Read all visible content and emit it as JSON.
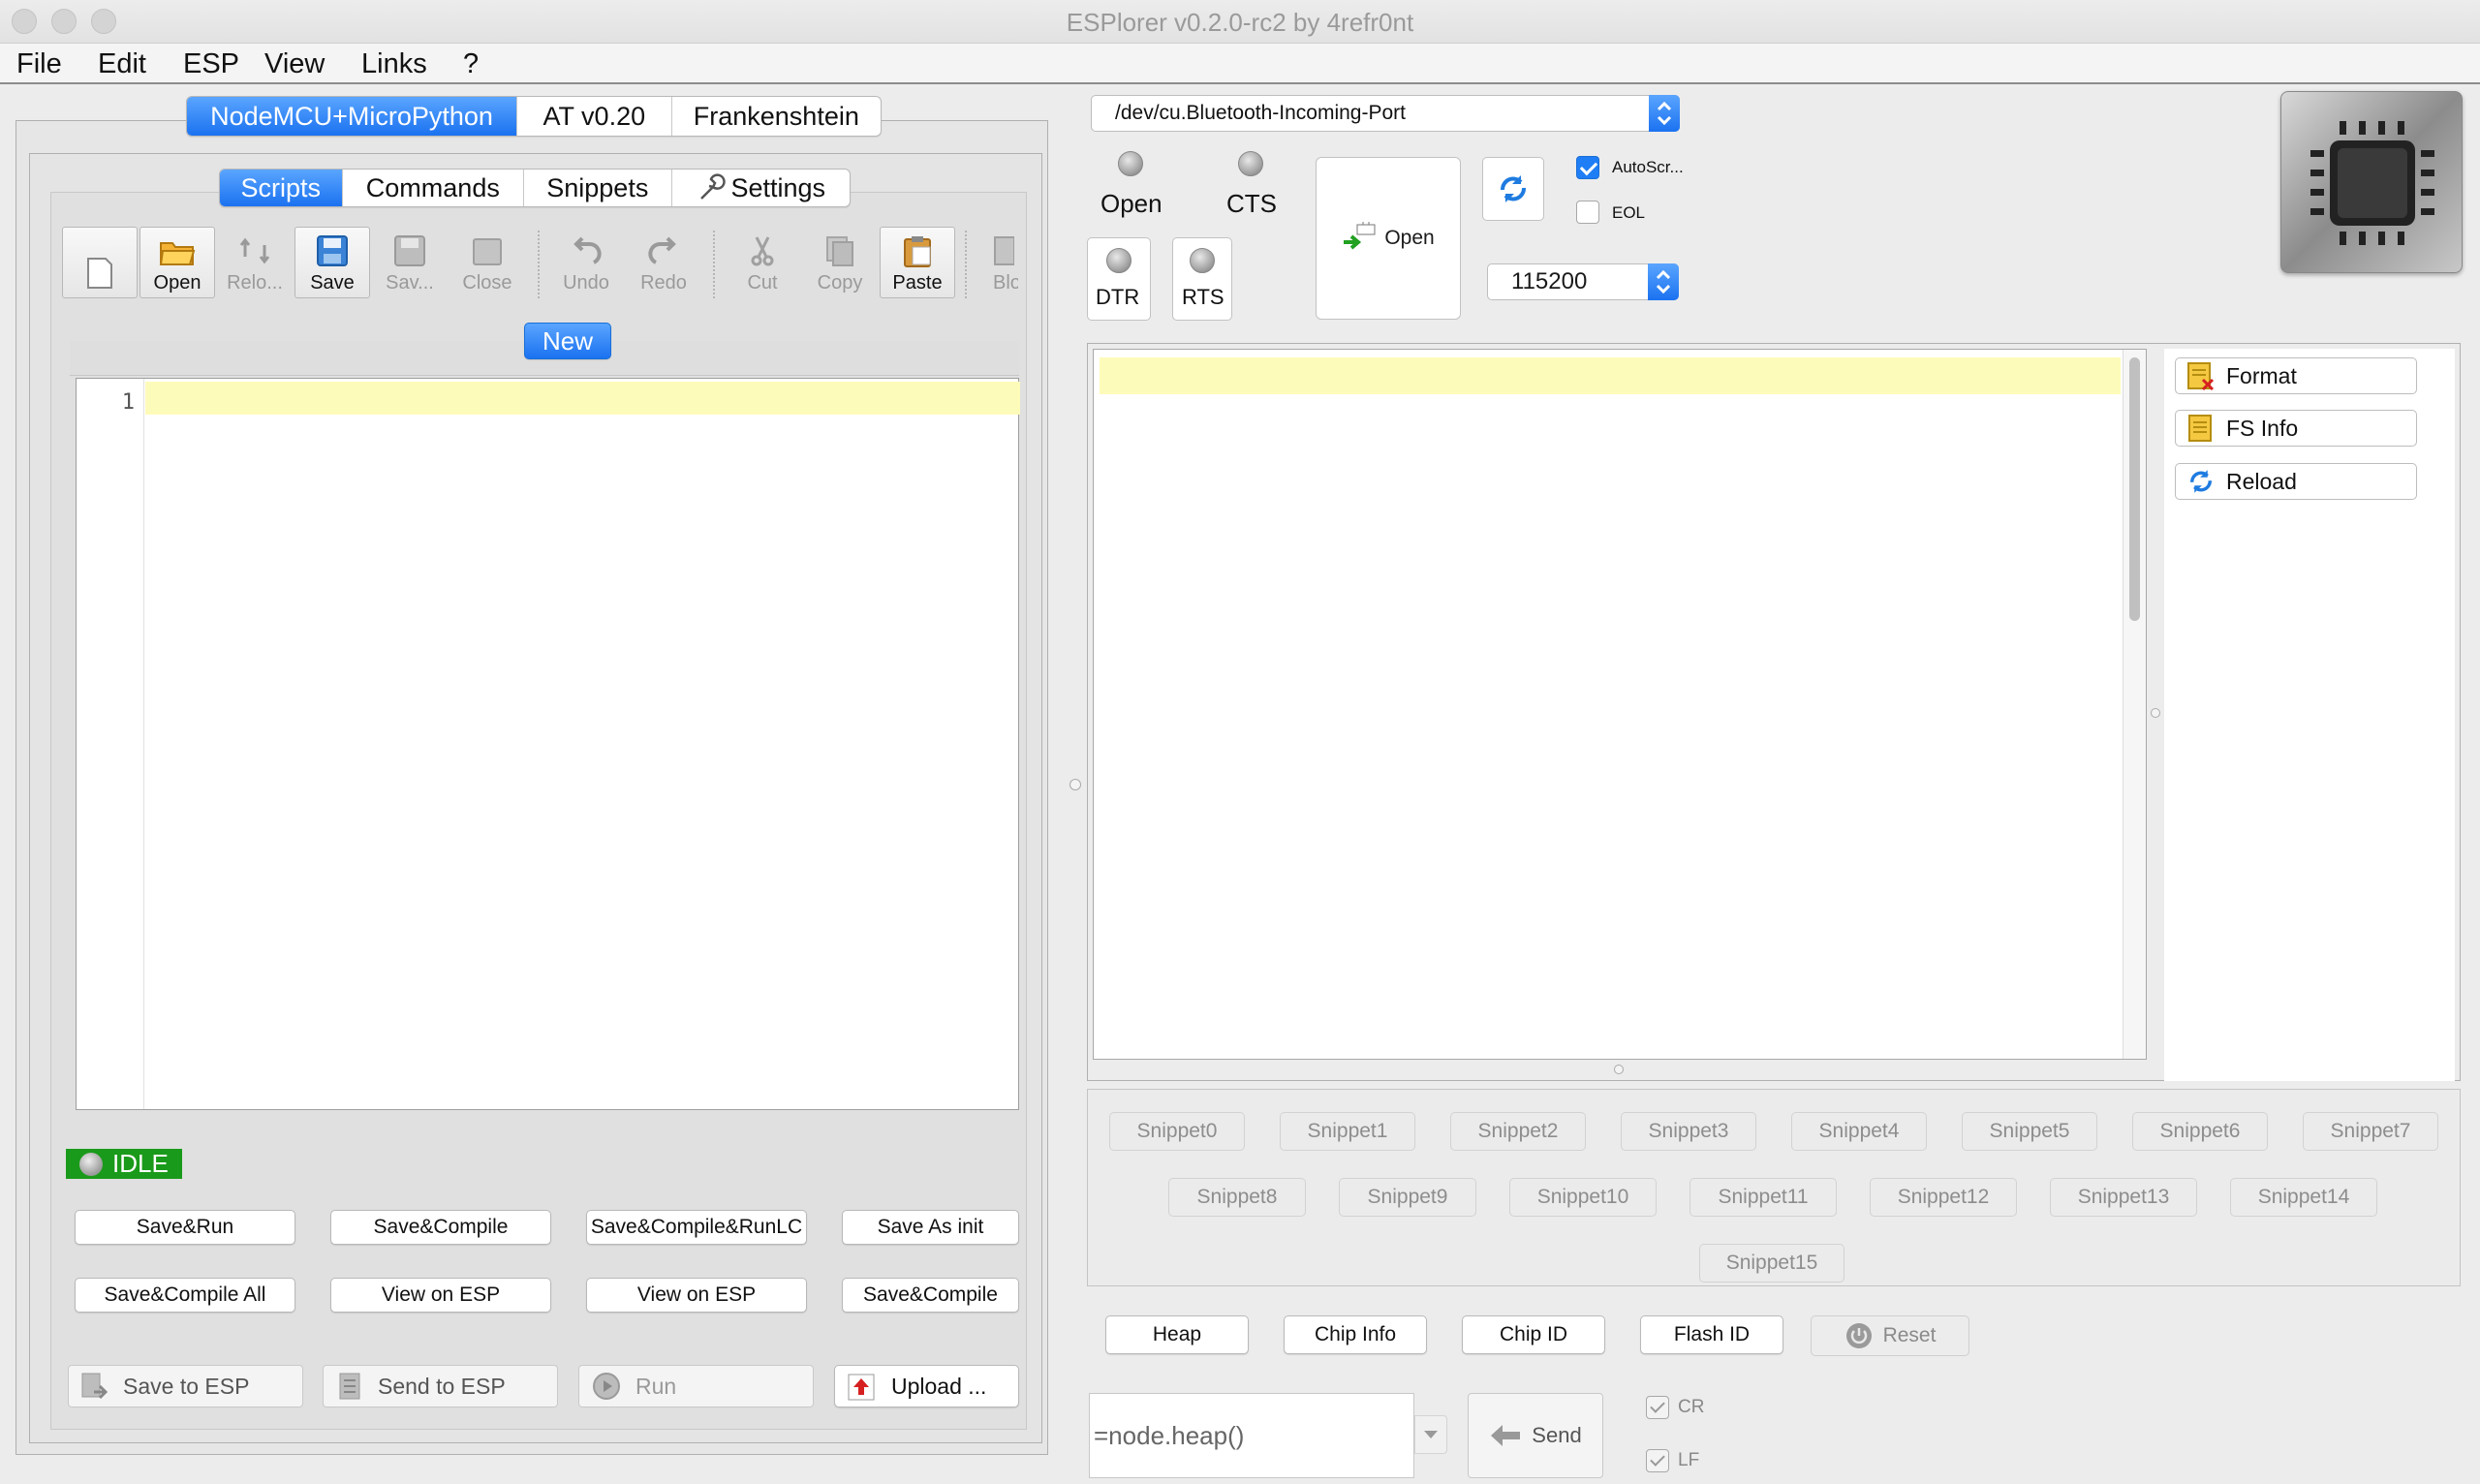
{
  "window": {
    "title": "ESPlorer v0.2.0-rc2 by 4refr0nt"
  },
  "menu": [
    "File",
    "Edit",
    "ESP",
    "View",
    "Links",
    "?"
  ],
  "firmware_tabs": [
    "NodeMCU+MicroPython",
    "AT v0.20",
    "Frankenshtein"
  ],
  "sub_tabs": [
    "Scripts",
    "Commands",
    "Snippets",
    "Settings"
  ],
  "toolbar": {
    "open": "Open",
    "reload": "Relo...",
    "save": "Save",
    "saveas": "Sav...",
    "close": "Close",
    "undo": "Undo",
    "redo": "Redo",
    "cut": "Cut",
    "copy": "Copy",
    "paste": "Paste",
    "block": "Blo"
  },
  "editor": {
    "doc_tab": "New",
    "line_number": "1"
  },
  "status": {
    "label": "IDLE",
    "color": "#1a9a1a"
  },
  "actions": {
    "row1": [
      "Save&Run",
      "Save&Compile",
      "Save&Compile&RunLC",
      "Save As init"
    ],
    "row2": [
      "Save&Compile All",
      "View on ESP",
      "View on ESP",
      "Save&Compile"
    ]
  },
  "bottom_actions": {
    "save_to_esp": "Save to ESP",
    "send_to_esp": "Send to ESP",
    "run": "Run",
    "upload": "Upload ..."
  },
  "port": {
    "value": "/dev/cu.Bluetooth-Incoming-Port"
  },
  "leds": {
    "open": "Open",
    "cts": "CTS",
    "dtr": "DTR",
    "rts": "RTS"
  },
  "open_button": "Open",
  "baud": "115200",
  "options": {
    "autoscroll": "AutoScr...",
    "eol": "EOL"
  },
  "side_buttons": {
    "format": "Format",
    "fs_info": "FS Info",
    "reload": "Reload"
  },
  "snippets": {
    "row1": [
      "Snippet0",
      "Snippet1",
      "Snippet2",
      "Snippet3",
      "Snippet4",
      "Snippet5",
      "Snippet6",
      "Snippet7"
    ],
    "row2": [
      "Snippet8",
      "Snippet9",
      "Snippet10",
      "Snippet11",
      "Snippet12",
      "Snippet13",
      "Snippet14"
    ],
    "row3": [
      "Snippet15"
    ]
  },
  "info_buttons": {
    "heap": "Heap",
    "chip_info": "Chip Info",
    "chip_id": "Chip ID",
    "flash_id": "Flash ID",
    "reset": "Reset"
  },
  "command": {
    "value": "=node.heap()",
    "send": "Send",
    "cr": "CR",
    "lf": "LF"
  }
}
